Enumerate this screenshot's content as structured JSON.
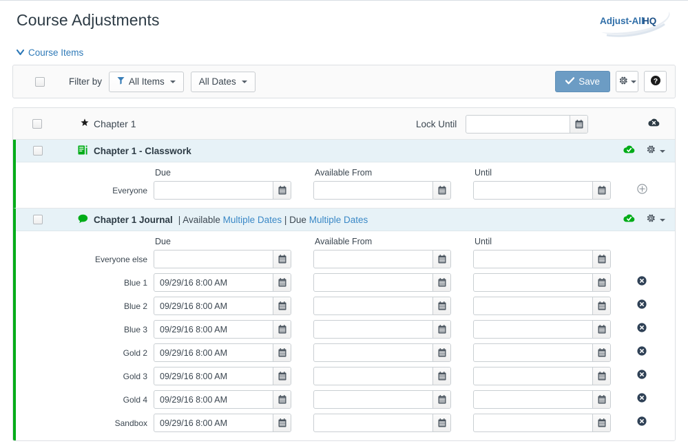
{
  "header": {
    "title": "Course Adjustments",
    "brand": "Adjust-All HQ"
  },
  "course_items_toggle": {
    "label": "Course Items",
    "caret_icon": "chevron-down-icon"
  },
  "toolbar": {
    "filter_label": "Filter by",
    "filter_items_button": "All Items",
    "filter_items_icon": "filter-funnel-icon",
    "filter_dates_button": "All Dates",
    "save_label": "Save",
    "save_icon": "check-icon",
    "gear_icon": "gear-icon",
    "help_label": "?",
    "help_icon": "help-icon",
    "accent_blue": "#6c9cc4"
  },
  "chapter": {
    "title": "Chapter 1",
    "star_icon": "star-icon",
    "lock_label": "Lock Until",
    "lock_value": "",
    "calendar_icon": "calendar-icon",
    "status_icon": "cloud-unpublished-icon"
  },
  "columns": {
    "due": "Due",
    "available_from": "Available From",
    "until": "Until"
  },
  "items": [
    {
      "icon": "quiz-document-icon",
      "name": "Chapter 1 - Classwork",
      "meta_available_label": "",
      "meta_available_value": "",
      "meta_due_label": "",
      "meta_due_value": "",
      "status_icon": "cloud-published-icon",
      "gear_icon": "gear-icon",
      "rows": [
        {
          "label": "Everyone",
          "due": "",
          "available_from": "",
          "until": "",
          "action_icon": "add-circle-icon"
        }
      ]
    },
    {
      "icon": "discussion-bubble-icon",
      "name": "Chapter 1 Journal",
      "meta_available_label": "| Available",
      "meta_available_value": "Multiple Dates",
      "meta_due_label": "| Due",
      "meta_due_value": "Multiple Dates",
      "status_icon": "cloud-published-icon",
      "gear_icon": "gear-icon",
      "rows": [
        {
          "label": "Everyone else",
          "due": "",
          "available_from": "",
          "until": "",
          "action_icon": ""
        },
        {
          "label": "Blue 1",
          "due": "09/29/16 8:00 AM",
          "available_from": "",
          "until": "",
          "action_icon": "remove-circle-icon"
        },
        {
          "label": "Blue 2",
          "due": "09/29/16 8:00 AM",
          "available_from": "",
          "until": "",
          "action_icon": "remove-circle-icon"
        },
        {
          "label": "Blue 3",
          "due": "09/29/16 8:00 AM",
          "available_from": "",
          "until": "",
          "action_icon": "remove-circle-icon"
        },
        {
          "label": "Gold 2",
          "due": "09/29/16 8:00 AM",
          "available_from": "",
          "until": "",
          "action_icon": "remove-circle-icon"
        },
        {
          "label": "Gold 3",
          "due": "09/29/16 8:00 AM",
          "available_from": "",
          "until": "",
          "action_icon": "remove-circle-icon"
        },
        {
          "label": "Gold 4",
          "due": "09/29/16 8:00 AM",
          "available_from": "",
          "until": "",
          "action_icon": "remove-circle-icon"
        },
        {
          "label": "Sandbox",
          "due": "09/29/16 8:00 AM",
          "available_from": "",
          "until": "",
          "action_icon": "remove-circle-icon"
        }
      ]
    }
  ],
  "colors": {
    "published_green": "#00ac18",
    "item_header_blue": "#e7f2f7",
    "link_blue": "#3a88c6"
  }
}
